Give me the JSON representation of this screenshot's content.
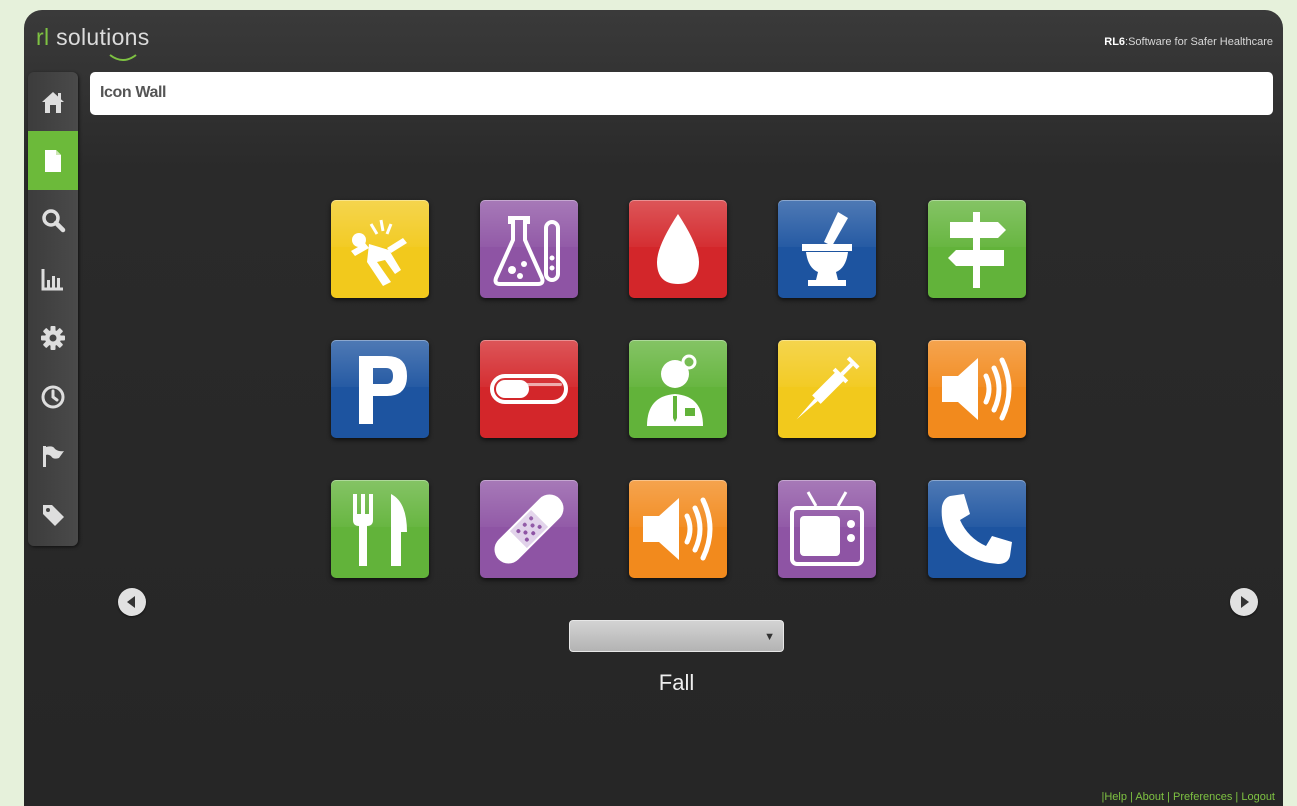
{
  "header": {
    "logo_prefix": "rl",
    "logo_suffix": "solutions",
    "tagline_brand": "RL6",
    "tagline_text": ":Software for Safer Healthcare"
  },
  "page": {
    "title": "Icon Wall"
  },
  "sidebar": {
    "items": [
      {
        "icon": "home-icon",
        "active": false
      },
      {
        "icon": "document-icon",
        "active": true
      },
      {
        "icon": "search-icon",
        "active": false
      },
      {
        "icon": "bar-chart-icon",
        "active": false
      },
      {
        "icon": "gear-icon",
        "active": false
      },
      {
        "icon": "clock-icon",
        "active": false
      },
      {
        "icon": "flag-icon",
        "active": false
      },
      {
        "icon": "tag-icon",
        "active": false
      }
    ]
  },
  "icon_wall": {
    "tiles": [
      {
        "icon": "fall-icon",
        "color": "#f2c91c"
      },
      {
        "icon": "lab-flask-icon",
        "color": "#8e54a4"
      },
      {
        "icon": "blood-drop-icon",
        "color": "#d3262a"
      },
      {
        "icon": "mortar-pestle-icon",
        "color": "#1d54a0"
      },
      {
        "icon": "signpost-icon",
        "color": "#62b33a"
      },
      {
        "icon": "parking-icon",
        "color": "#1d54a0"
      },
      {
        "icon": "pill-icon",
        "color": "#d3262a"
      },
      {
        "icon": "doctor-icon",
        "color": "#62b33a"
      },
      {
        "icon": "syringe-icon",
        "color": "#f2c91c"
      },
      {
        "icon": "speaker-icon",
        "color": "#f28a1d"
      },
      {
        "icon": "fork-knife-icon",
        "color": "#62b33a"
      },
      {
        "icon": "bandage-icon",
        "color": "#8e54a4"
      },
      {
        "icon": "speaker-icon",
        "color": "#f28a1d"
      },
      {
        "icon": "television-icon",
        "color": "#8e54a4"
      },
      {
        "icon": "phone-icon",
        "color": "#1d54a0"
      }
    ],
    "selected_value": "",
    "selected_label": "Fall"
  },
  "footer": {
    "sep": "|",
    "links": [
      "Help",
      "About",
      "Preferences",
      "Logout"
    ]
  }
}
